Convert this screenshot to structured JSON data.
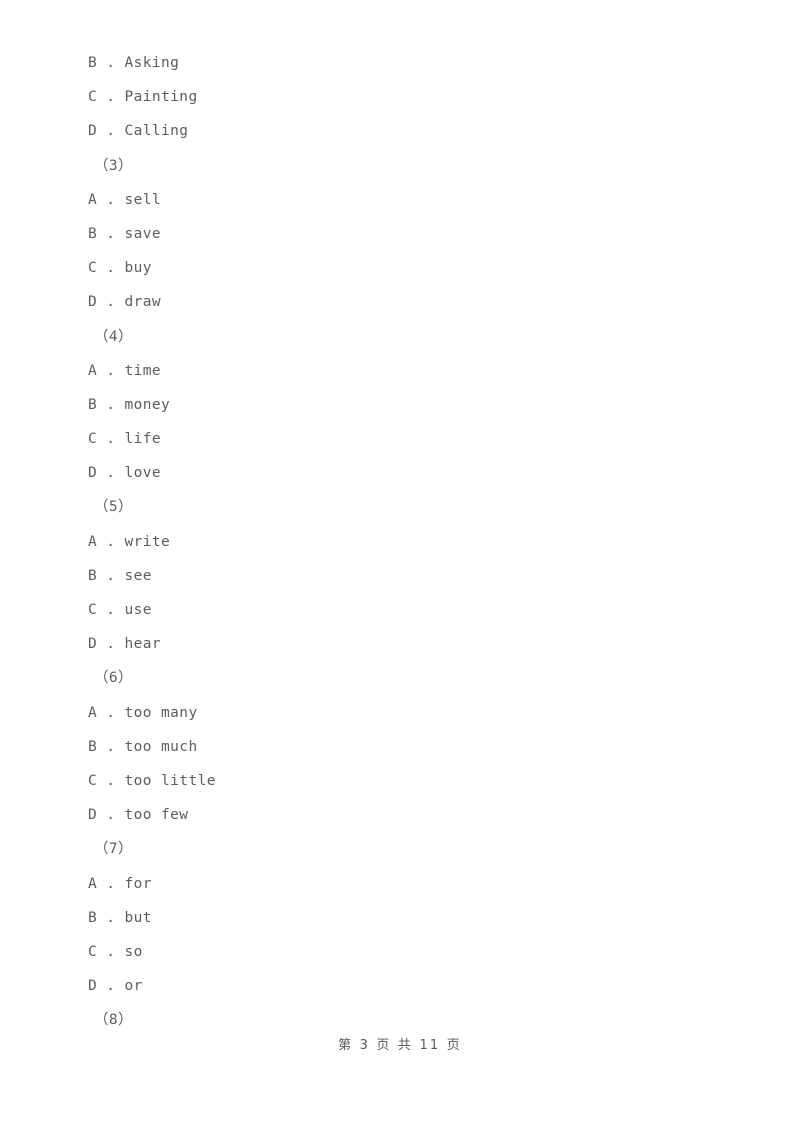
{
  "page": {
    "background_color": "#ffffff",
    "text_color": "#5d5d5d"
  },
  "document": {
    "lines": [
      {
        "type": "option",
        "letter": "B",
        "separator": " . ",
        "text": "Asking"
      },
      {
        "type": "option",
        "letter": "C",
        "separator": " . ",
        "text": "Painting"
      },
      {
        "type": "option",
        "letter": "D",
        "separator": " . ",
        "text": "Calling"
      },
      {
        "type": "question_number",
        "text": "（3）"
      },
      {
        "type": "option",
        "letter": "A",
        "separator": " . ",
        "text": "sell"
      },
      {
        "type": "option",
        "letter": "B",
        "separator": " . ",
        "text": "save"
      },
      {
        "type": "option",
        "letter": "C",
        "separator": " . ",
        "text": "buy"
      },
      {
        "type": "option",
        "letter": "D",
        "separator": " . ",
        "text": "draw"
      },
      {
        "type": "question_number",
        "text": "（4）"
      },
      {
        "type": "option",
        "letter": "A",
        "separator": " . ",
        "text": "time"
      },
      {
        "type": "option",
        "letter": "B",
        "separator": " . ",
        "text": "money"
      },
      {
        "type": "option",
        "letter": "C",
        "separator": " . ",
        "text": "life"
      },
      {
        "type": "option",
        "letter": "D",
        "separator": " . ",
        "text": "love"
      },
      {
        "type": "question_number",
        "text": "（5）"
      },
      {
        "type": "option",
        "letter": "A",
        "separator": " . ",
        "text": "write"
      },
      {
        "type": "option",
        "letter": "B",
        "separator": " . ",
        "text": "see"
      },
      {
        "type": "option",
        "letter": "C",
        "separator": " . ",
        "text": "use"
      },
      {
        "type": "option",
        "letter": "D",
        "separator": " . ",
        "text": "hear"
      },
      {
        "type": "question_number",
        "text": "（6）"
      },
      {
        "type": "option",
        "letter": "A",
        "separator": " . ",
        "text": "too many"
      },
      {
        "type": "option",
        "letter": "B",
        "separator": " . ",
        "text": "too much"
      },
      {
        "type": "option",
        "letter": "C",
        "separator": " . ",
        "text": "too little"
      },
      {
        "type": "option",
        "letter": "D",
        "separator": " . ",
        "text": "too few"
      },
      {
        "type": "question_number",
        "text": "（7）"
      },
      {
        "type": "option",
        "letter": "A",
        "separator": " . ",
        "text": "for"
      },
      {
        "type": "option",
        "letter": "B",
        "separator": " . ",
        "text": "but"
      },
      {
        "type": "option",
        "letter": "C",
        "separator": " . ",
        "text": "so"
      },
      {
        "type": "option",
        "letter": "D",
        "separator": " . ",
        "text": "or"
      },
      {
        "type": "question_number",
        "text": "（8）"
      }
    ]
  },
  "footer": {
    "text": "第 3 页 共 11 页",
    "current_page": "3",
    "total_pages": "11"
  }
}
